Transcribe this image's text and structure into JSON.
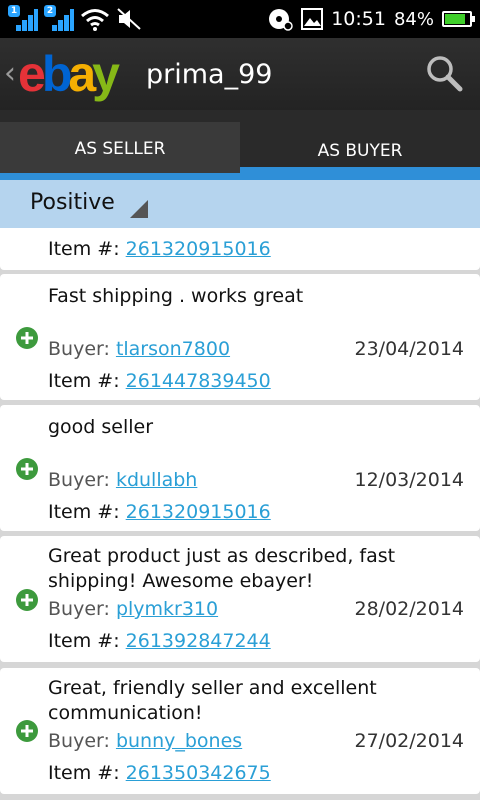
{
  "status_bar": {
    "sim1_badge": "1",
    "sim2_badge": "2",
    "time": "10:51",
    "battery_percent": "84%",
    "battery_level": 0.84
  },
  "app_bar": {
    "logo": "ebay",
    "title": "prima_99",
    "icons": [
      "back-chevron-icon",
      "search-icon"
    ]
  },
  "tabs": {
    "seller": "AS SELLER",
    "buyer": "AS BUYER",
    "selected": "AS BUYER"
  },
  "filter": {
    "selected": "Positive"
  },
  "labels": {
    "buyer": "Buyer:",
    "item": "Item #:"
  },
  "feedback": [
    {
      "comment": "",
      "buyer": "",
      "date": "",
      "item": "261320915016"
    },
    {
      "comment": "Fast shipping . works great",
      "buyer": "tlarson7800",
      "date": "23/04/2014",
      "item": "261447839450"
    },
    {
      "comment": "good seller",
      "buyer": "kdullabh",
      "date": "12/03/2014",
      "item": "261320915016"
    },
    {
      "comment": "Great product just as described, fast shipping! Awesome ebayer!",
      "buyer": "plymkr310",
      "date": "28/02/2014",
      "item": "261392847244"
    },
    {
      "comment": "Great, friendly seller and excellent communication!",
      "buyer": "bunny_bones",
      "date": "27/02/2014",
      "item": "261350342675"
    }
  ],
  "colors": {
    "tab_indicator": "#2f8fd8",
    "filter_bar": "#b5d4ee",
    "link": "#2a9fd6",
    "positive_icon": "#3d9a3d"
  }
}
